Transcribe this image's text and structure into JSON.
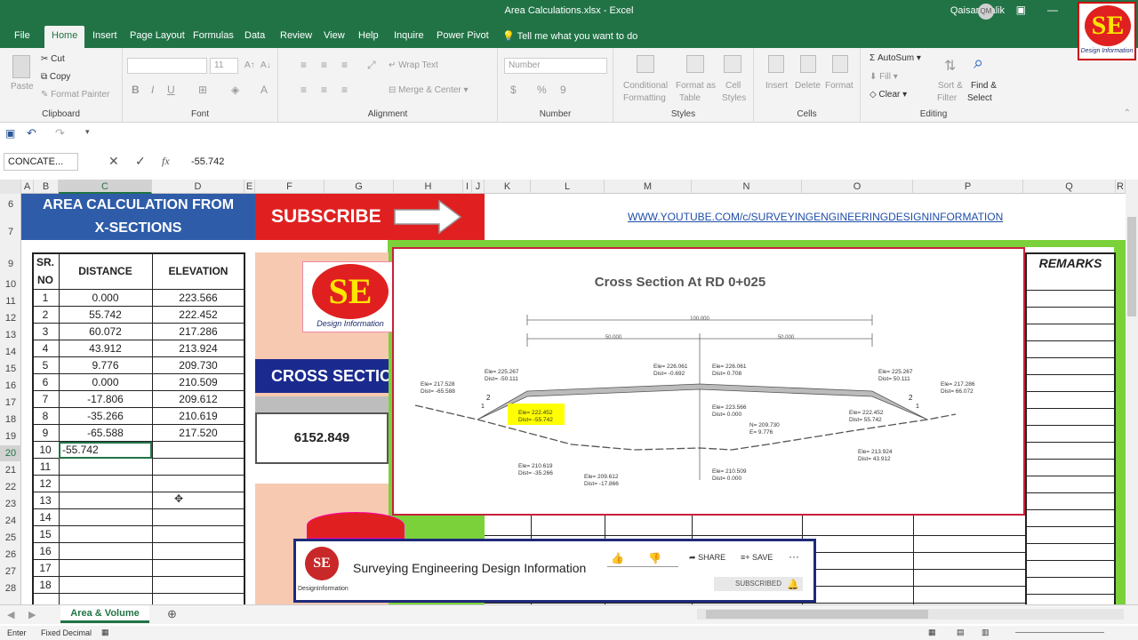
{
  "window": {
    "title": "Area Calculations.xlsx  -  Excel",
    "user": "Qaisar Malik",
    "initials": "QM"
  },
  "logo": {
    "text": "SE",
    "sub": "Design Information"
  },
  "tabs": [
    "File",
    "Home",
    "Insert",
    "Page Layout",
    "Formulas",
    "Data",
    "Review",
    "View",
    "Help",
    "Inquire",
    "Power Pivot"
  ],
  "tell_me": "Tell me what you want to do",
  "ribbon": {
    "clipboard": {
      "label": "Clipboard",
      "paste": "Paste",
      "cut": "Cut",
      "copy": "Copy",
      "format_painter": "Format Painter"
    },
    "font": {
      "label": "Font",
      "size": "11",
      "bold": "B",
      "italic": "I",
      "underline": "U"
    },
    "alignment": {
      "label": "Alignment",
      "wrap": "Wrap Text",
      "merge": "Merge & Center"
    },
    "number": {
      "label": "Number",
      "format": "Number",
      "currency": "$",
      "percent": "%",
      "comma": "9"
    },
    "styles": {
      "label": "Styles",
      "conditional": "Conditional",
      "conditional2": "Formatting",
      "format_as": "Format as",
      "table": "Table",
      "cell": "Cell",
      "cell_styles": "Styles"
    },
    "cells": {
      "label": "Cells",
      "insert": "Insert",
      "delete": "Delete",
      "format": "Format"
    },
    "editing": {
      "label": "Editing",
      "autosum": "AutoSum",
      "fill": "Fill",
      "clear": "Clear",
      "sort": "Sort &",
      "filter": "Filter",
      "find": "Find &",
      "select": "Select"
    }
  },
  "formula_bar": {
    "name_box": "CONCATE...",
    "value": "-55.742"
  },
  "columns": [
    "A",
    "B",
    "C",
    "D",
    "E",
    "F",
    "G",
    "H",
    "I",
    "J",
    "K",
    "L",
    "M",
    "N",
    "O",
    "P",
    "Q",
    "R"
  ],
  "rows": [
    "6",
    "7",
    "9",
    "10",
    "11",
    "12",
    "13",
    "14",
    "15",
    "16",
    "17",
    "18",
    "19",
    "20",
    "21",
    "22",
    "23",
    "24",
    "25",
    "26",
    "27",
    "28"
  ],
  "banner": {
    "area_title_1": "AREA CALCULATION FROM",
    "area_title_2": "X-SECTIONS",
    "subscribe": "SUBSCRIBE",
    "url": "WWW.YOUTUBE.COM/c/SURVEYINGENGINEERINGDESIGNINFORMATION"
  },
  "table": {
    "headers": {
      "sr_1": "SR.",
      "sr_2": "NO",
      "distance": "DISTANCE",
      "elevation": "ELEVATION"
    },
    "rows": [
      {
        "sr": "1",
        "dist": "0.000",
        "elev": "223.566"
      },
      {
        "sr": "2",
        "dist": "55.742",
        "elev": "222.452"
      },
      {
        "sr": "3",
        "dist": "60.072",
        "elev": "217.286"
      },
      {
        "sr": "4",
        "dist": "43.912",
        "elev": "213.924"
      },
      {
        "sr": "5",
        "dist": "9.776",
        "elev": "209.730"
      },
      {
        "sr": "6",
        "dist": "0.000",
        "elev": "210.509"
      },
      {
        "sr": "7",
        "dist": "-17.806",
        "elev": "209.612"
      },
      {
        "sr": "8",
        "dist": "-35.266",
        "elev": "210.619"
      },
      {
        "sr": "9",
        "dist": "-65.588",
        "elev": "217.520"
      },
      {
        "sr": "10",
        "dist": "-55.742",
        "elev": ""
      },
      {
        "sr": "11",
        "dist": "",
        "elev": ""
      },
      {
        "sr": "12",
        "dist": "",
        "elev": ""
      },
      {
        "sr": "13",
        "dist": "",
        "elev": ""
      },
      {
        "sr": "14",
        "dist": "",
        "elev": ""
      },
      {
        "sr": "15",
        "dist": "",
        "elev": ""
      },
      {
        "sr": "16",
        "dist": "",
        "elev": ""
      },
      {
        "sr": "17",
        "dist": "",
        "elev": ""
      },
      {
        "sr": "18",
        "dist": "",
        "elev": ""
      }
    ]
  },
  "cross_section_panel": {
    "title": "CROSS SECTIO",
    "value": "6152.849",
    "remarks": "REMARKS"
  },
  "drawing": {
    "title": "Cross Section At RD 0+025",
    "dim_total": "100.000",
    "dim_left": "50.000",
    "dim_right": "50.000",
    "labels": [
      {
        "t1": "Ele= 217.528",
        "t2": "Dist= -65.588"
      },
      {
        "t1": "Ele= 225.267",
        "t2": "Dist= -50.111"
      },
      {
        "t1": "Ele= 226.061",
        "t2": "Dist= -0.692"
      },
      {
        "t1": "Ele= 226.061",
        "t2": "Dist= 0.708"
      },
      {
        "t1": "Ele= 225.267",
        "t2": "Dist= 50.111"
      },
      {
        "t1": "Ele= 217.286",
        "t2": "Dist= 66.072"
      },
      {
        "t1": "Ele= 222.452",
        "t2": "Dist= -55.742"
      },
      {
        "t1": "Ele= 223.566",
        "t2": "Dist= 0.000"
      },
      {
        "t1": "Ele= 222.452",
        "t2": "Dist= 55.742"
      },
      {
        "t1": "N= 209.730",
        "t2": "E= 9.776"
      },
      {
        "t1": "Ele= 213.924",
        "t2": "Dist= 43.912"
      },
      {
        "t1": "Ele= 210.619",
        "t2": "Dist= -35.266"
      },
      {
        "t1": "Ele= 209.612",
        "t2": "Dist= -17.866"
      },
      {
        "t1": "Ele= 210.509",
        "t2": "Dist= 0.000"
      }
    ],
    "slope_left": "2",
    "slope_left_b": "1",
    "slope_right": "2",
    "slope_right_b": "1"
  },
  "youtube": {
    "channel": "Surveying Engineering Design Information",
    "share": "SHARE",
    "save": "SAVE",
    "subscribed": "SUBSCRIBED",
    "logo_sub": "DesignInformation"
  },
  "sheet_tab": "Area & Volume",
  "status": {
    "mode": "Enter",
    "fixed": "Fixed Decimal"
  },
  "colors": {
    "excel_green": "#217346",
    "navy": "#1f3e7a",
    "red": "#e02020",
    "peach": "#f7c9b0",
    "lime": "#7bd13a"
  }
}
